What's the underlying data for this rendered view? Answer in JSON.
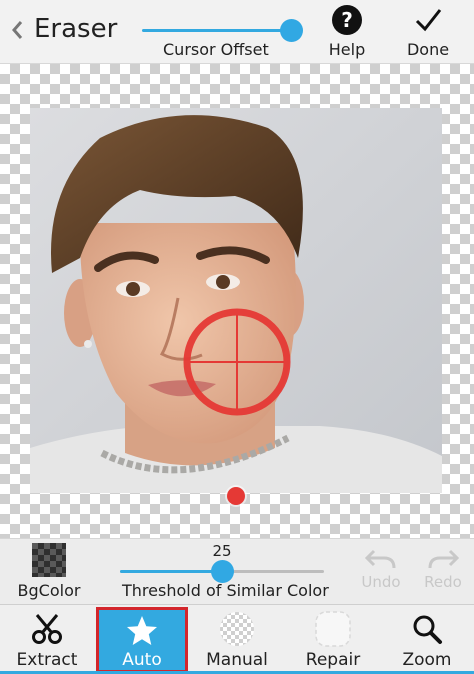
{
  "header": {
    "title": "Eraser",
    "cursor_offset_label": "Cursor Offset",
    "cursor_offset_level": 0.92,
    "help_label": "Help",
    "done_label": "Done"
  },
  "threshold": {
    "bgcolor_label": "BgColor",
    "value": "25",
    "level": 0.5,
    "label": "Threshold of Similar Color",
    "undo_label": "Undo",
    "redo_label": "Redo"
  },
  "tools": [
    {
      "label": "Extract",
      "icon": "scissors-icon"
    },
    {
      "label": "Auto",
      "icon": "star-icon",
      "selected": true
    },
    {
      "label": "Manual",
      "icon": "transparent-brush-icon"
    },
    {
      "label": "Repair",
      "icon": "repair-brush-icon"
    },
    {
      "label": "Zoom",
      "icon": "magnifier-icon"
    }
  ],
  "colors": {
    "accent": "#33a9e0",
    "selection_border": "#d3262c",
    "cursor_red": "#e53935",
    "disabled_text": "#c8c8c8"
  }
}
